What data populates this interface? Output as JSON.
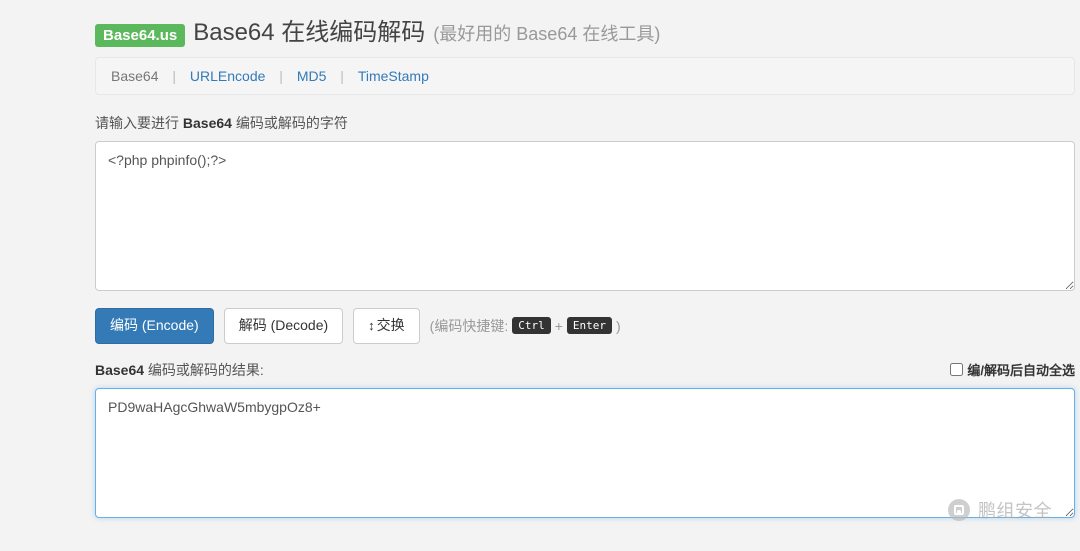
{
  "header": {
    "badge": "Base64.us",
    "title": "Base64 在线编码解码",
    "subtitle": "(最好用的 Base64 在线工具)"
  },
  "nav": {
    "items": [
      {
        "label": "Base64",
        "active": true
      },
      {
        "label": "URLEncode",
        "active": false
      },
      {
        "label": "MD5",
        "active": false
      },
      {
        "label": "TimeStamp",
        "active": false
      }
    ],
    "separator": "|"
  },
  "input": {
    "label_prefix": "请输入要进行 ",
    "label_bold": "Base64",
    "label_suffix": " 编码或解码的字符",
    "value": "<?php phpinfo();?>"
  },
  "buttons": {
    "encode": "编码 (Encode)",
    "decode": "解码 (Decode)",
    "swap": "交换",
    "swap_icon": "↕"
  },
  "shortcut": {
    "prefix": "(编码快捷键: ",
    "key1": "Ctrl",
    "plus": "+",
    "key2": "Enter",
    "suffix": ")"
  },
  "result": {
    "label_bold": "Base64",
    "label_suffix": " 编码或解码的结果:",
    "auto_select_label": "编/解码后自动全选",
    "auto_select_checked": false,
    "value": "PD9waHAgcGhwaW5mbygpOz8+"
  },
  "watermark": {
    "text": "鹏组安全"
  }
}
